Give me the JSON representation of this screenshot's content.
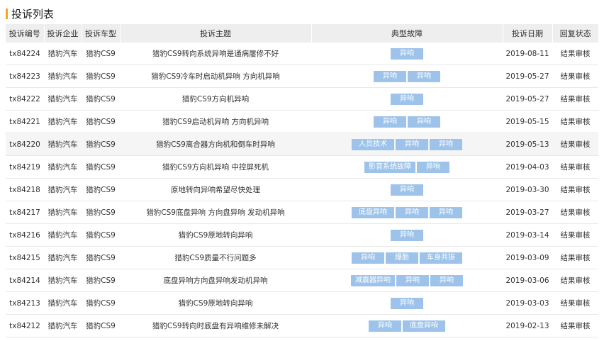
{
  "page_title": "投诉列表",
  "columns": [
    "投诉编号",
    "投诉企业",
    "投诉车型",
    "投诉主题",
    "典型故障",
    "投诉日期",
    "回复状态"
  ],
  "rows": [
    {
      "id": "tx84224",
      "company": "猎豹汽车",
      "model": "猎豹CS9",
      "subject": "猎豹CS9转向系统异响是通病屡修不好",
      "tags": [
        "异响"
      ],
      "date": "2019-08-11",
      "status": "结果审核"
    },
    {
      "id": "tx84223",
      "company": "猎豹汽车",
      "model": "猎豹CS9",
      "subject": "猎豹CS9冷车时启动机异响 方向机异响",
      "tags": [
        "异响",
        "异响"
      ],
      "date": "2019-05-27",
      "status": "结果审核"
    },
    {
      "id": "tx84222",
      "company": "猎豹汽车",
      "model": "猎豹CS9",
      "subject": "猎豹CS9方向机异响",
      "tags": [
        "异响"
      ],
      "date": "2019-05-27",
      "status": "结果审核"
    },
    {
      "id": "tx84221",
      "company": "猎豹汽车",
      "model": "猎豹CS9",
      "subject": "猎豹CS9启动机异响 方向机异响",
      "tags": [
        "异响",
        "异响"
      ],
      "date": "2019-05-15",
      "status": "结果审核"
    },
    {
      "id": "tx84220",
      "company": "猎豹汽车",
      "model": "猎豹CS9",
      "subject": "猎豹CS9离合器方向机和倒车时异响",
      "tags": [
        "人员技术",
        "异响",
        "异响"
      ],
      "date": "2019-05-13",
      "status": "结果审核",
      "highlight": true
    },
    {
      "id": "tx84219",
      "company": "猎豹汽车",
      "model": "猎豹CS9",
      "subject": "猎豹CS9方向机异响 中控屏死机",
      "tags": [
        "影音系统故障",
        "异响"
      ],
      "date": "2019-04-03",
      "status": "结果审核"
    },
    {
      "id": "tx84218",
      "company": "猎豹汽车",
      "model": "猎豹CS9",
      "subject": "原地转向异响希望尽快处理",
      "tags": [
        "异响"
      ],
      "date": "2019-03-30",
      "status": "结果审核"
    },
    {
      "id": "tx84217",
      "company": "猎豹汽车",
      "model": "猎豹CS9",
      "subject": "猎豹CS9底盘异响 方向盘异响 发动机异响",
      "tags": [
        "底盘异响",
        "异响",
        "异响"
      ],
      "date": "2019-03-27",
      "status": "结果审核"
    },
    {
      "id": "tx84216",
      "company": "猎豹汽车",
      "model": "猎豹CS9",
      "subject": "猎豹CS9原地转向异响",
      "tags": [
        "异响"
      ],
      "date": "2019-03-14",
      "status": "结果审核"
    },
    {
      "id": "tx84215",
      "company": "猎豹汽车",
      "model": "猎豹CS9",
      "subject": "猎豹CS9质量不行问题多",
      "tags": [
        "异响",
        "爆胎",
        "车身共振"
      ],
      "date": "2019-03-09",
      "status": "结果审核"
    },
    {
      "id": "tx84214",
      "company": "猎豹汽车",
      "model": "猎豹CS9",
      "subject": "底盘异响方向盘异响发动机异响",
      "tags": [
        "减震器异响",
        "异响",
        "异响"
      ],
      "date": "2019-03-06",
      "status": "结果审核"
    },
    {
      "id": "tx84213",
      "company": "猎豹汽车",
      "model": "猎豹CS9",
      "subject": "猎豹CS9原地转向异响",
      "tags": [
        "异响"
      ],
      "date": "2019-03-03",
      "status": "结果审核"
    },
    {
      "id": "tx84212",
      "company": "猎豹汽车",
      "model": "猎豹CS9",
      "subject": "猎豹CS9转向时底盘有异响维修未解决",
      "tags": [
        "异响",
        "底盘异响"
      ],
      "date": "2019-02-13",
      "status": "结果审核"
    }
  ],
  "colors": {
    "accent": "#f5a623",
    "tag_bg": "#9dc3ea",
    "header_bg": "#eeeeee",
    "row_highlight": "#f5f5f5"
  }
}
